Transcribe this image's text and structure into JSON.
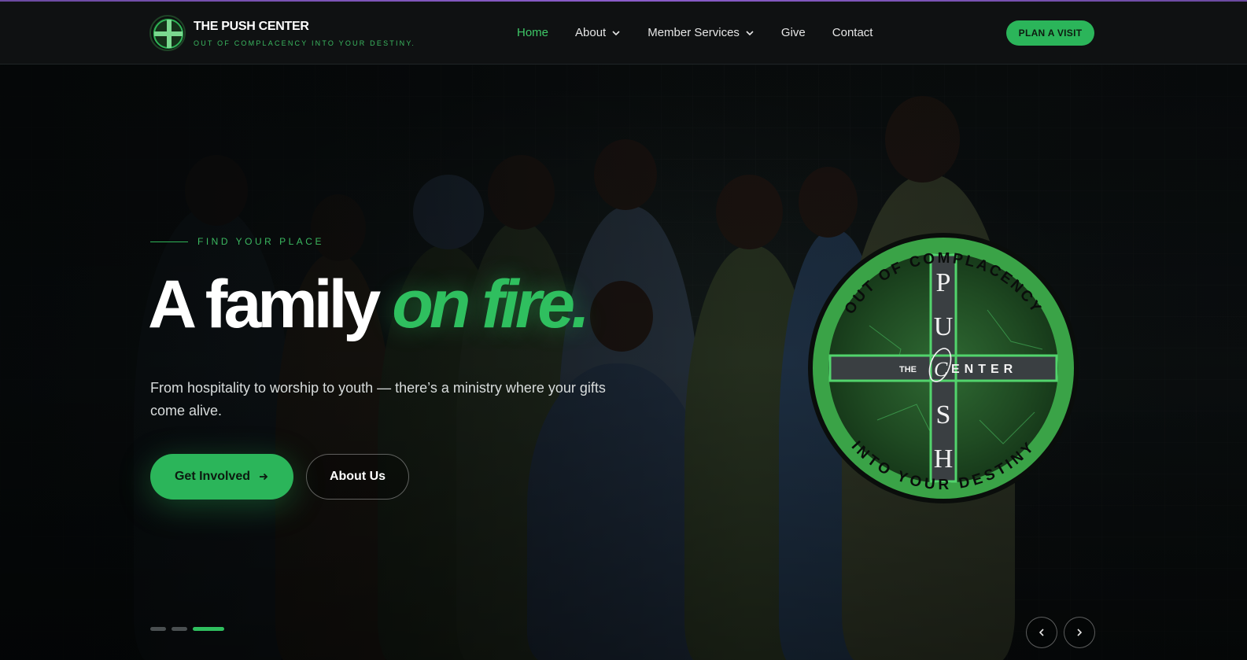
{
  "brand": {
    "title": "THE PUSH CENTER",
    "tagline": "OUT OF COMPLACENCY INTO YOUR DESTINY."
  },
  "nav": {
    "items": [
      {
        "label": "Home",
        "active": true,
        "dropdown": false
      },
      {
        "label": "About",
        "active": false,
        "dropdown": true
      },
      {
        "label": "Member Services",
        "active": false,
        "dropdown": true
      },
      {
        "label": "Give",
        "active": false,
        "dropdown": false
      },
      {
        "label": "Contact",
        "active": false,
        "dropdown": false
      }
    ],
    "cta_label": "PLAN A VISIT"
  },
  "hero": {
    "eyebrow": "FIND YOUR PLACE",
    "headline_white": "A family",
    "headline_green": "on fire.",
    "subtitle": "From hospitality to worship to youth — there’s a ministry where your gifts come alive.",
    "primary_button": "Get Involved",
    "secondary_button": "About Us",
    "slides_total": 3,
    "active_slide": 3
  },
  "emblem": {
    "ring_top": "OUT OF COMPLACENCY",
    "ring_bottom": "INTO YOUR DESTINY",
    "letters": [
      "P",
      "U",
      "S",
      "H"
    ],
    "the": "THE",
    "center_c": "C",
    "center_rest": "ENTER"
  },
  "colors": {
    "accent": "#2bb55a",
    "accent_text": "#3ec867",
    "background": "#0b0d0e",
    "top_line": "#8a5cc9"
  },
  "icons": {
    "chevron": "chevron-down-icon",
    "arrow_right": "arrow-right-icon",
    "prev": "chevron-left-icon",
    "next": "chevron-right-icon"
  }
}
